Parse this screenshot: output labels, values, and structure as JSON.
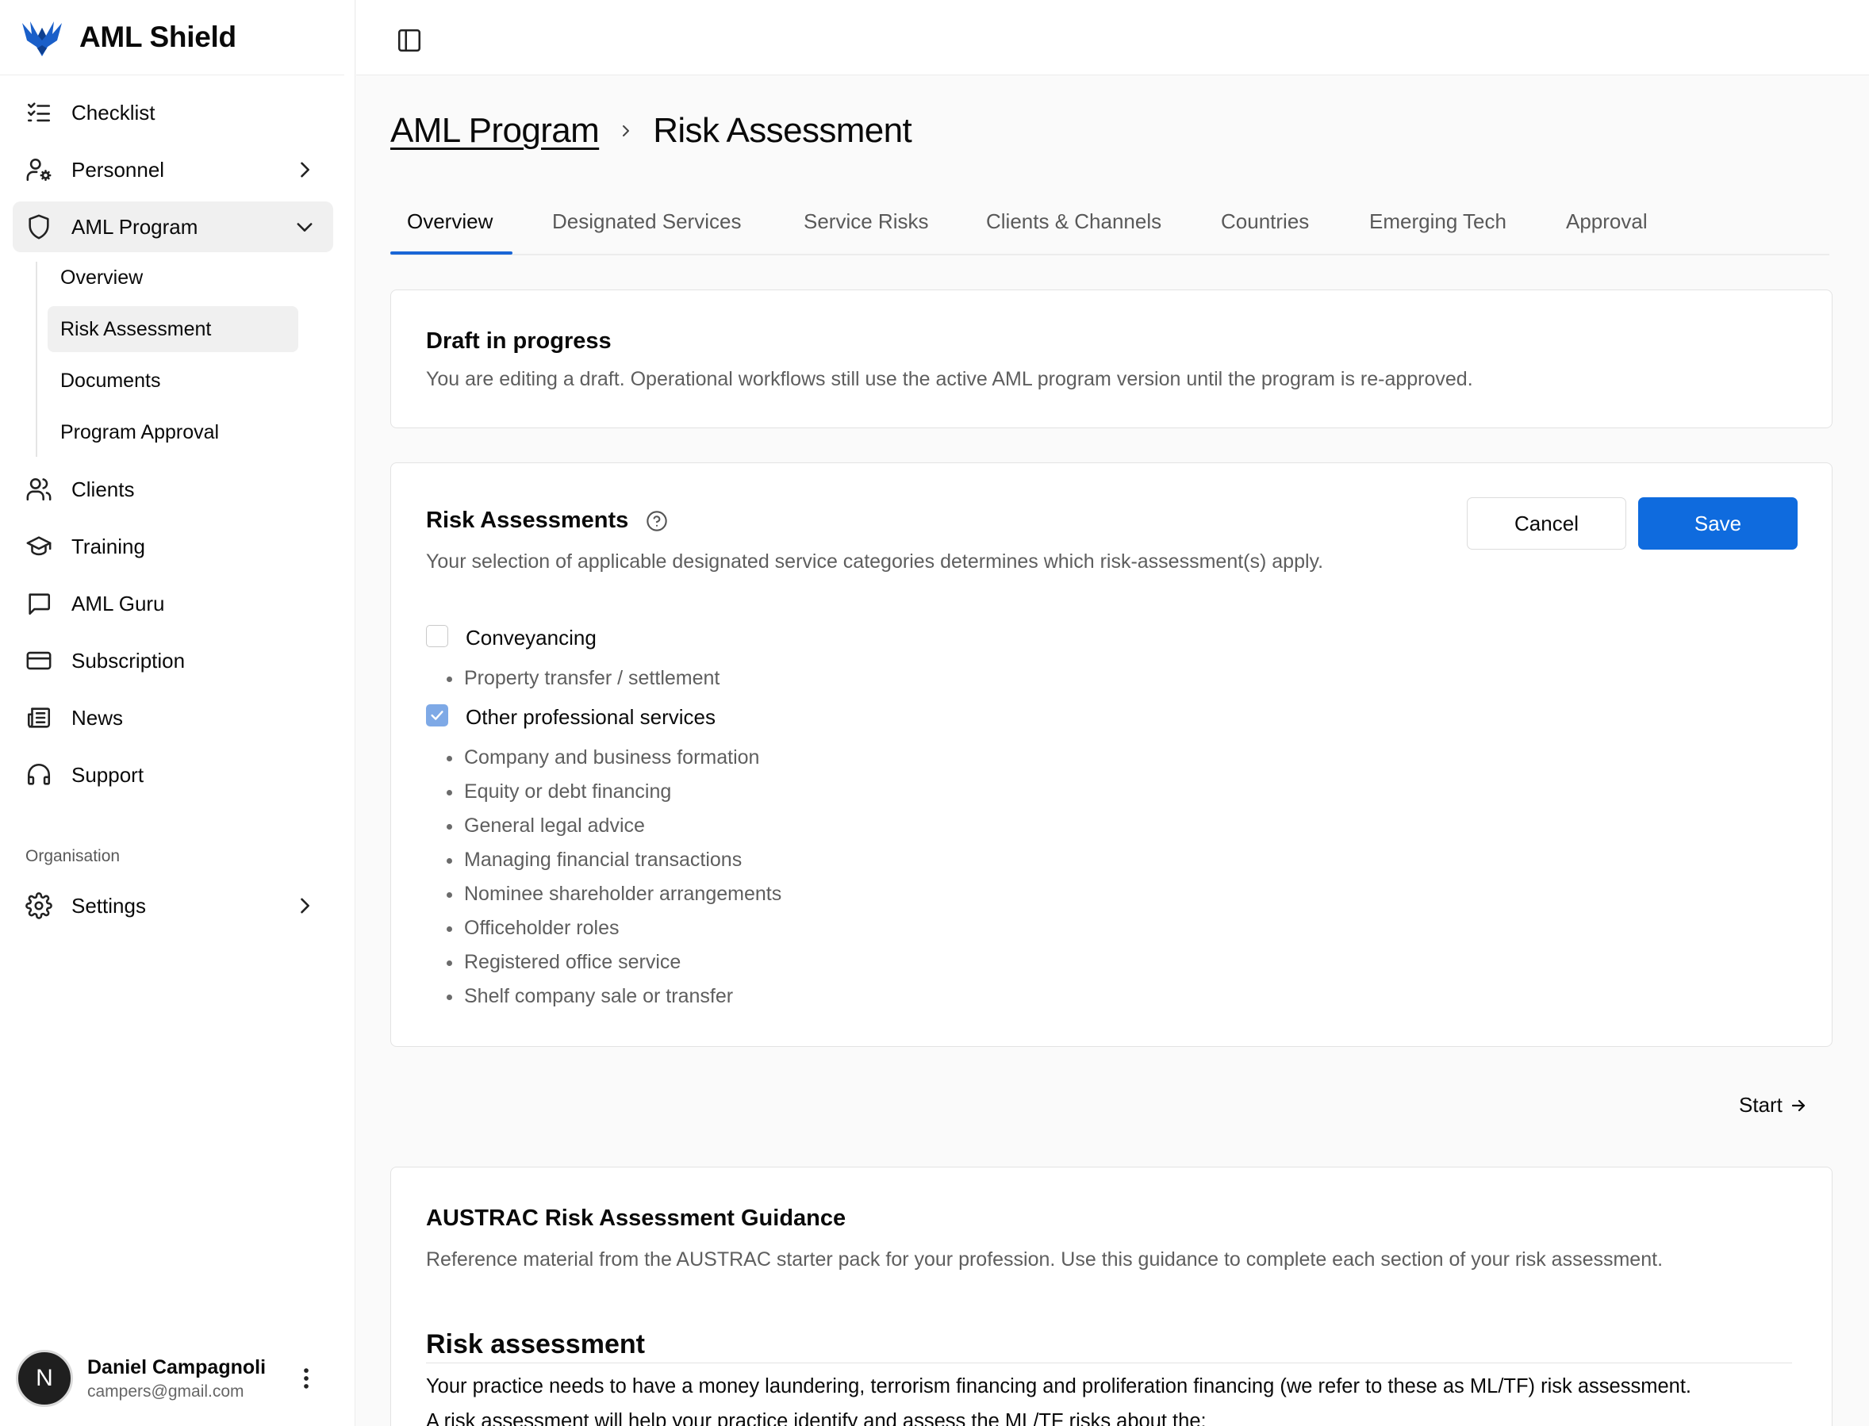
{
  "app": {
    "name": "AML Shield",
    "accent_color": "#0f6bde"
  },
  "sidebar": {
    "items": [
      {
        "label": "Checklist",
        "icon": "checklist-icon"
      },
      {
        "label": "Personnel",
        "icon": "user-cog-icon"
      },
      {
        "label": "AML Program",
        "icon": "shield-icon"
      },
      {
        "label": "Clients",
        "icon": "users-icon"
      },
      {
        "label": "Training",
        "icon": "graduation-cap-icon"
      },
      {
        "label": "AML Guru",
        "icon": "message-square-icon"
      },
      {
        "label": "Subscription",
        "icon": "credit-card-icon"
      },
      {
        "label": "News",
        "icon": "newspaper-icon"
      },
      {
        "label": "Support",
        "icon": "headphones-icon"
      }
    ],
    "aml_program_sub": [
      {
        "label": "Overview"
      },
      {
        "label": "Risk Assessment"
      },
      {
        "label": "Documents"
      },
      {
        "label": "Program Approval"
      }
    ],
    "section_label": "Organisation",
    "settings_label": "Settings"
  },
  "user": {
    "initial": "N",
    "name": "Daniel Campagnoli",
    "email": "campers@gmail.com"
  },
  "breadcrumb": {
    "parent": "AML Program",
    "current": "Risk Assessment"
  },
  "tabs": [
    {
      "label": "Overview",
      "active": true
    },
    {
      "label": "Designated Services"
    },
    {
      "label": "Service Risks"
    },
    {
      "label": "Clients & Channels"
    },
    {
      "label": "Countries"
    },
    {
      "label": "Emerging Tech"
    },
    {
      "label": "Approval"
    }
  ],
  "draft": {
    "title": "Draft in progress",
    "description": "You are editing a draft. Operational workflows still use the active AML program version until the program is re-approved."
  },
  "risk_assessments": {
    "title": "Risk Assessments",
    "description": "Your selection of applicable designated service categories determines which risk-assessment(s) apply.",
    "cancel_label": "Cancel",
    "save_label": "Save",
    "categories": [
      {
        "label": "Conveyancing",
        "checked": false,
        "services": [
          "Property transfer / settlement"
        ]
      },
      {
        "label": "Other professional services",
        "checked": true,
        "services": [
          "Company and business formation",
          "Equity or debt financing",
          "General legal advice",
          "Managing financial transactions",
          "Nominee shareholder arrangements",
          "Officeholder roles",
          "Registered office service",
          "Shelf company sale or transfer"
        ]
      }
    ]
  },
  "start_label": "Start",
  "guidance": {
    "title": "AUSTRAC Risk Assessment Guidance",
    "description": "Reference material from the AUSTRAC starter pack for your profession. Use this guidance to complete each section of your risk assessment.",
    "heading": "Risk assessment",
    "paragraph": "Your practice needs to have a money laundering, terrorism financing and proliferation financing (we refer to these as ML/TF) risk assessment.",
    "paragraph2": "A risk assessment will help your practice identify and assess the ML/TF risks about the:"
  }
}
